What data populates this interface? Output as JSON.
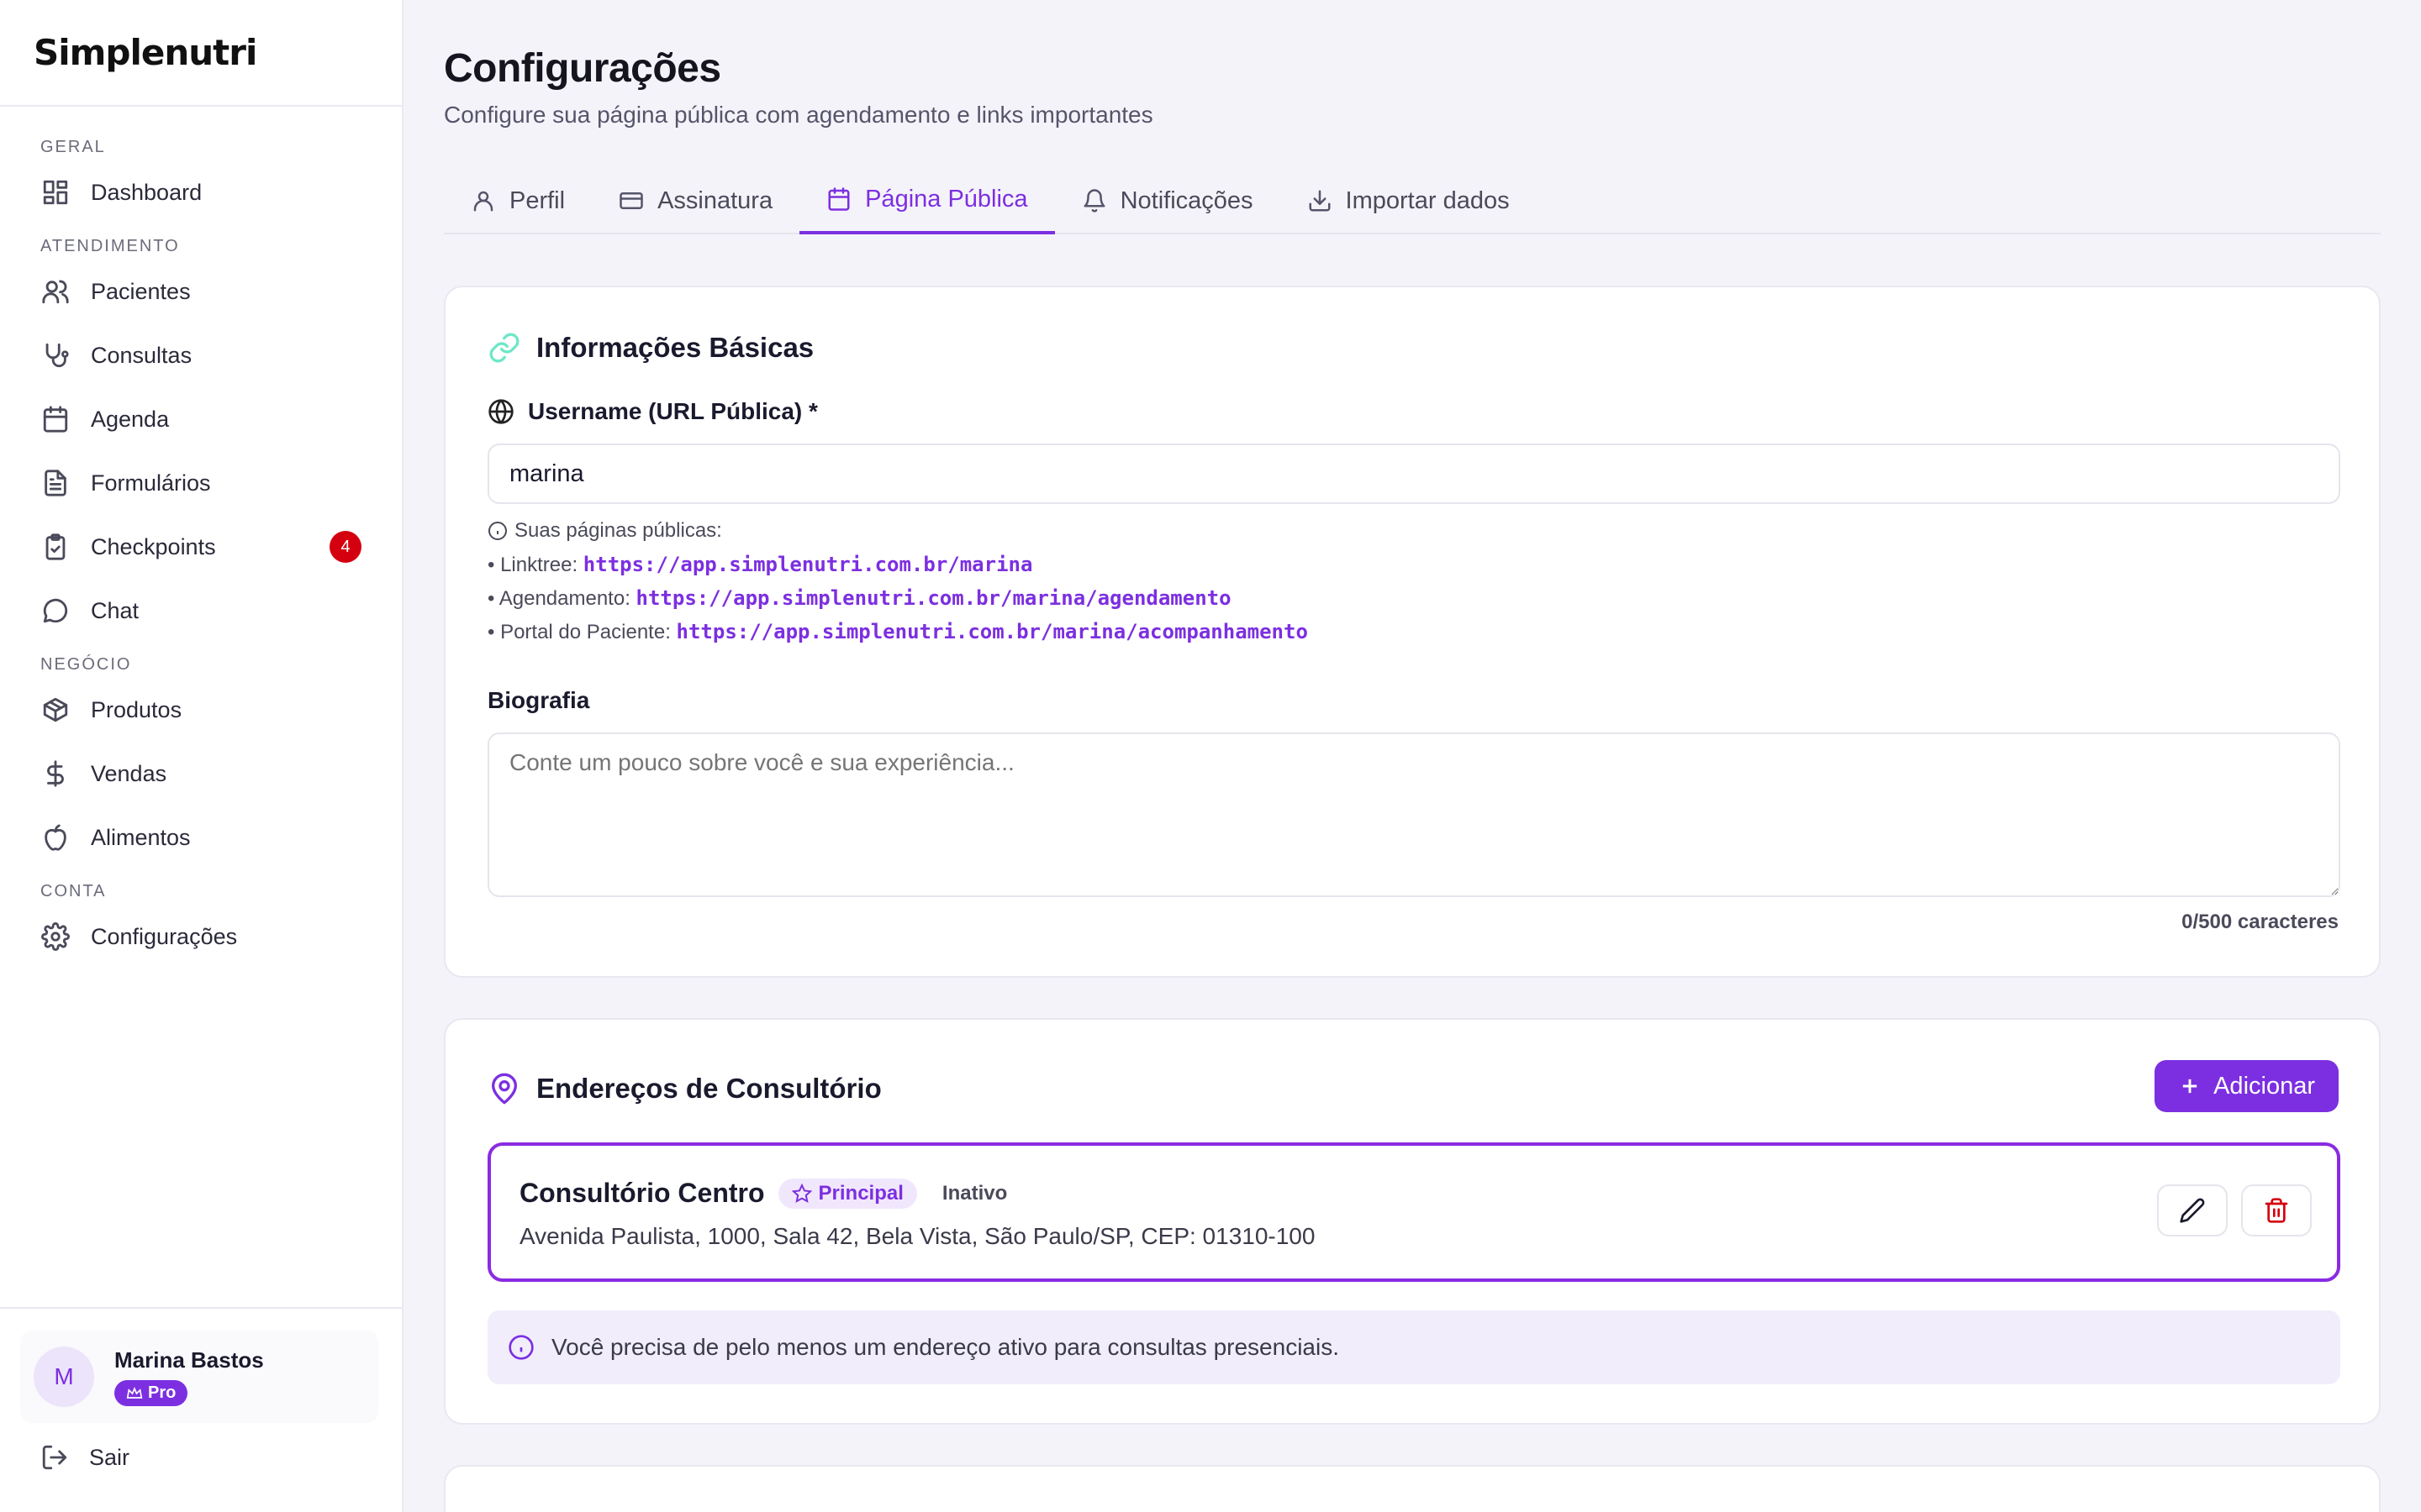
{
  "app": {
    "logo": "Simplenutri"
  },
  "sidebar": {
    "sections": {
      "geral": "GERAL",
      "atendimento": "ATENDIMENTO",
      "negocio": "NEGÓCIO",
      "conta": "CONTA"
    },
    "items": {
      "dashboard": "Dashboard",
      "pacientes": "Pacientes",
      "consultas": "Consultas",
      "agenda": "Agenda",
      "formularios": "Formulários",
      "checkpoints": "Checkpoints",
      "checkpoints_badge": "4",
      "chat": "Chat",
      "produtos": "Produtos",
      "vendas": "Vendas",
      "alimentos": "Alimentos",
      "configuracoes": "Configurações"
    },
    "user": {
      "initial": "M",
      "name": "Marina Bastos",
      "plan": "Pro"
    },
    "logout": "Sair"
  },
  "header": {
    "title": "Configurações",
    "subtitle": "Configure sua página pública com agendamento e links importantes"
  },
  "tabs": {
    "perfil": "Perfil",
    "assinatura": "Assinatura",
    "pagina_publica": "Página Pública",
    "notificacoes": "Notificações",
    "importar": "Importar dados"
  },
  "basic_info": {
    "title": "Informações Básicas",
    "username_label": "Username (URL Pública) *",
    "username_value": "marina",
    "public_pages_hint": "Suas páginas públicas:",
    "links": {
      "linktree_label": "• Linktree: ",
      "linktree_url": "https://app.simplenutri.com.br/marina",
      "agendamento_label": "• Agendamento: ",
      "agendamento_url": "https://app.simplenutri.com.br/marina/agendamento",
      "portal_label": "• Portal do Paciente: ",
      "portal_url": "https://app.simplenutri.com.br/marina/acompanhamento"
    },
    "bio_label": "Biografia",
    "bio_placeholder": "Conte um pouco sobre você e sua experiência...",
    "char_count": "0/500 caracteres"
  },
  "addresses": {
    "title": "Endereços de Consultório",
    "add_label": "Adicionar",
    "items": [
      {
        "name": "Consultório Centro",
        "principal_tag": "Principal",
        "status": "Inativo",
        "address": "Avenida Paulista, 1000, Sala 42, Bela Vista, São Paulo/SP, CEP: 01310-100"
      }
    ],
    "notice": "Você precisa de pelo menos um endereço ativo para consultas presenciais."
  },
  "colors": {
    "accent": "#7c2fe0",
    "danger": "#d4000f",
    "link_icon": "#6ee7c7"
  }
}
